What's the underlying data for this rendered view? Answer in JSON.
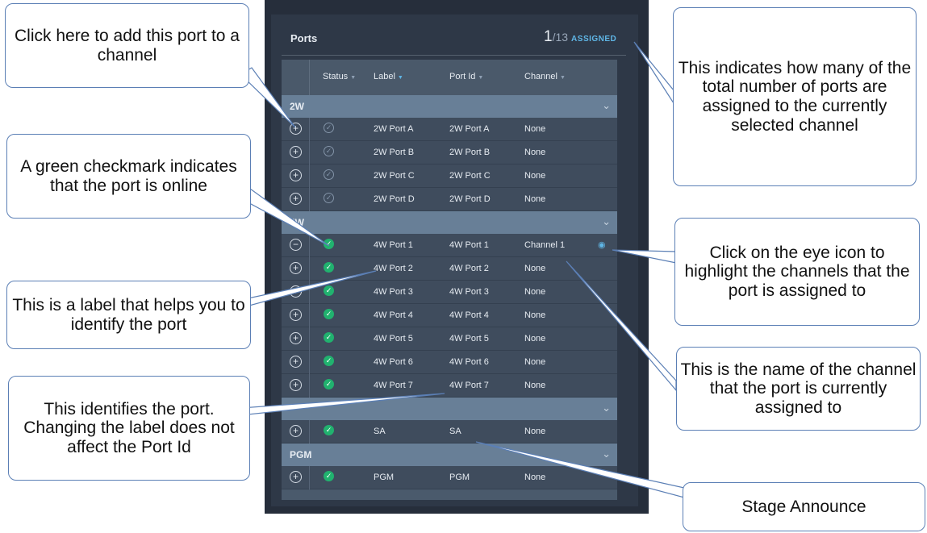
{
  "ports": {
    "title": "Ports",
    "assigned_count": "1",
    "assigned_total": "/13",
    "assigned_label": "ASSIGNED",
    "columns": {
      "status": "Status",
      "label": "Label",
      "port_id": "Port Id",
      "channel": "Channel"
    },
    "groups": [
      {
        "name": "2W",
        "rows": [
          {
            "status": "offline",
            "label": "2W Port A",
            "port_id": "2W Port A",
            "channel": "None"
          },
          {
            "status": "offline",
            "label": "2W Port B",
            "port_id": "2W Port B",
            "channel": "None"
          },
          {
            "status": "offline",
            "label": "2W Port C",
            "port_id": "2W Port C",
            "channel": "None"
          },
          {
            "status": "offline",
            "label": "2W Port D",
            "port_id": "2W Port D",
            "channel": "None"
          }
        ]
      },
      {
        "name": "4W",
        "rows": [
          {
            "status": "online",
            "label": "4W Port 1",
            "port_id": "4W Port 1",
            "channel": "Channel 1",
            "assigned": true
          },
          {
            "status": "online",
            "label": "4W Port 2",
            "port_id": "4W Port 2",
            "channel": "None"
          },
          {
            "status": "online",
            "label": "4W Port 3",
            "port_id": "4W Port 3",
            "channel": "None"
          },
          {
            "status": "online",
            "label": "4W Port 4",
            "port_id": "4W Port 4",
            "channel": "None"
          },
          {
            "status": "online",
            "label": "4W Port 5",
            "port_id": "4W Port 5",
            "channel": "None"
          },
          {
            "status": "online",
            "label": "4W Port 6",
            "port_id": "4W Port 6",
            "channel": "None"
          },
          {
            "status": "online",
            "label": "4W Port 7",
            "port_id": "4W Port 7",
            "channel": "None"
          }
        ]
      },
      {
        "name": "",
        "rows": [
          {
            "status": "online",
            "label": "SA",
            "port_id": "SA",
            "channel": "None"
          }
        ]
      },
      {
        "name": "PGM",
        "rows": [
          {
            "status": "online",
            "label": "PGM",
            "port_id": "PGM",
            "channel": "None"
          }
        ]
      }
    ]
  },
  "callouts": {
    "add_port": "Click here to add this port to a channel",
    "assigned_count": "This indicates how many of the total number of ports are assigned to the currently selected channel",
    "green_check": "A green checkmark indicates that the port is online",
    "eye_icon": "Click on the eye icon to highlight the channels that the port is assigned to",
    "label": "This is a label that helps you to identify the port",
    "channel_name": "This is the name of the channel that the port is currently assigned to",
    "port_id": "This identifies the port. Changing the label does not affect the Port Id",
    "stage_announce": "Stage Announce"
  },
  "colors": {
    "online": "#21b26f",
    "accent": "#5fb6e6",
    "panel": "#262e3b",
    "group_header": "#687f97"
  }
}
